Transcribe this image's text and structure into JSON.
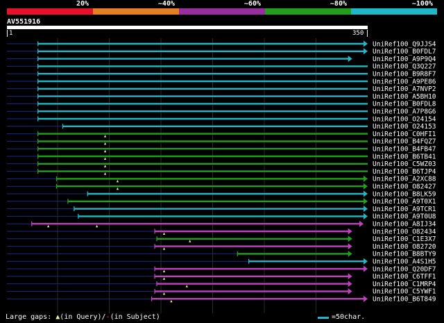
{
  "identity_scale": [
    {
      "label": "20%",
      "color": "#e8102a"
    },
    {
      "label": "~40%",
      "color": "#e8801e"
    },
    {
      "label": "~60%",
      "color": "#9a2ea0"
    },
    {
      "label": "~80%",
      "color": "#22a01c"
    },
    {
      "label": "~100%",
      "color": "#20b8c8"
    }
  ],
  "query": {
    "id": "AV551916",
    "start_label": "1",
    "end_label": "350",
    "length": 350
  },
  "colors": {
    "cyan": "#20b8c8",
    "green": "#22a01c",
    "purple": "#c040c0",
    "dashed": "#1a2a8a",
    "gap": "#f0f0a0"
  },
  "hits": [
    {
      "name": "UniRef100_Q9JJS4",
      "color": "cyan",
      "start": 31,
      "end": 350,
      "arrow": true,
      "gaps": []
    },
    {
      "name": "UniRef100_B0FDL7",
      "color": "cyan",
      "start": 31,
      "end": 350,
      "arrow": true,
      "gaps": []
    },
    {
      "name": "UniRef100_A9P9Q4",
      "color": "cyan",
      "start": 31,
      "end": 335,
      "arrow": true,
      "gaps": []
    },
    {
      "name": "UniRef100_Q3Q227",
      "color": "cyan",
      "start": 31,
      "end": 350,
      "arrow": false,
      "gaps": []
    },
    {
      "name": "UniRef100_B9R8F7",
      "color": "cyan",
      "start": 31,
      "end": 350,
      "arrow": false,
      "gaps": []
    },
    {
      "name": "UniRef100_A9PE86",
      "color": "cyan",
      "start": 31,
      "end": 350,
      "arrow": false,
      "gaps": []
    },
    {
      "name": "UniRef100_A7NVP2",
      "color": "cyan",
      "start": 31,
      "end": 350,
      "arrow": false,
      "gaps": []
    },
    {
      "name": "UniRef100_A5BH10",
      "color": "cyan",
      "start": 31,
      "end": 350,
      "arrow": false,
      "gaps": []
    },
    {
      "name": "UniRef100_B0FDL8",
      "color": "cyan",
      "start": 31,
      "end": 350,
      "arrow": false,
      "gaps": []
    },
    {
      "name": "UniRef100_A7P8G6",
      "color": "cyan",
      "start": 31,
      "end": 350,
      "arrow": false,
      "gaps": []
    },
    {
      "name": "UniRef100_O24154",
      "color": "cyan",
      "start": 31,
      "end": 350,
      "arrow": false,
      "gaps": []
    },
    {
      "name": "UniRef100_O24153",
      "color": "cyan",
      "start": 55,
      "end": 350,
      "arrow": false,
      "gaps": []
    },
    {
      "name": "UniRef100_C0HFI1",
      "color": "green",
      "start": 31,
      "end": 350,
      "arrow": false,
      "gaps": [
        96
      ]
    },
    {
      "name": "UniRef100_B4FQZ7",
      "color": "green",
      "start": 31,
      "end": 350,
      "arrow": false,
      "gaps": [
        96
      ]
    },
    {
      "name": "UniRef100_B4FB47",
      "color": "green",
      "start": 31,
      "end": 350,
      "arrow": false,
      "gaps": [
        96
      ]
    },
    {
      "name": "UniRef100_B6TB41",
      "color": "green",
      "start": 31,
      "end": 350,
      "arrow": false,
      "gaps": [
        96
      ]
    },
    {
      "name": "UniRef100_C5WZ03",
      "color": "green",
      "start": 31,
      "end": 350,
      "arrow": false,
      "gaps": [
        96
      ]
    },
    {
      "name": "UniRef100_B6TJP4",
      "color": "green",
      "start": 31,
      "end": 350,
      "arrow": false,
      "gaps": [
        96
      ]
    },
    {
      "name": "UniRef100_A2XC88",
      "color": "green",
      "start": 49,
      "end": 350,
      "arrow": true,
      "gaps": [
        108
      ]
    },
    {
      "name": "UniRef100_O82427",
      "color": "green",
      "start": 49,
      "end": 350,
      "arrow": true,
      "gaps": [
        108
      ]
    },
    {
      "name": "UniRef100_B8LK59",
      "color": "cyan",
      "start": 79,
      "end": 350,
      "arrow": true,
      "gaps": []
    },
    {
      "name": "UniRef100_A9T0X1",
      "color": "green",
      "start": 60,
      "end": 350,
      "arrow": true,
      "gaps": []
    },
    {
      "name": "UniRef100_A9TCR1",
      "color": "cyan",
      "start": 66,
      "end": 350,
      "arrow": true,
      "gaps": []
    },
    {
      "name": "UniRef100_A9T0U8",
      "color": "cyan",
      "start": 70,
      "end": 350,
      "arrow": true,
      "gaps": []
    },
    {
      "name": "UniRef100_A8IJ34",
      "color": "purple",
      "start": 25,
      "end": 346,
      "arrow": true,
      "gaps": [
        41,
        88
      ]
    },
    {
      "name": "UniRef100_O82434",
      "color": "purple",
      "start": 144,
      "end": 335,
      "arrow": true,
      "gaps": [
        153
      ]
    },
    {
      "name": "UniRef100_C1E3X7",
      "color": "green",
      "start": 146,
      "end": 335,
      "arrow": true,
      "gaps": [
        178
      ]
    },
    {
      "name": "UniRef100_O82720",
      "color": "purple",
      "start": 144,
      "end": 335,
      "arrow": true,
      "gaps": [
        153
      ]
    },
    {
      "name": "UniRef100_B8BTY9",
      "color": "green",
      "start": 224,
      "end": 335,
      "arrow": true,
      "gaps": []
    },
    {
      "name": "UniRef100_A4S1H5",
      "color": "cyan",
      "start": 235,
      "end": 350,
      "arrow": true,
      "gaps": []
    },
    {
      "name": "UniRef100_Q20DF7",
      "color": "purple",
      "start": 144,
      "end": 350,
      "arrow": true,
      "gaps": [
        153
      ]
    },
    {
      "name": "UniRef100_C6TFF1",
      "color": "purple",
      "start": 144,
      "end": 335,
      "arrow": true,
      "gaps": [
        153
      ]
    },
    {
      "name": "UniRef100_C1MRP4",
      "color": "purple",
      "start": 146,
      "end": 335,
      "arrow": true,
      "gaps": [
        175
      ]
    },
    {
      "name": "UniRef100_C5YWF1",
      "color": "purple",
      "start": 144,
      "end": 335,
      "arrow": true,
      "gaps": [
        153
      ]
    },
    {
      "name": "UniRef100_B6T849",
      "color": "purple",
      "start": 141,
      "end": 350,
      "arrow": true,
      "gaps": [
        160
      ]
    }
  ],
  "footer": {
    "gaps_label": "Large gaps:",
    "in_query": "(in Query)/",
    "in_subject": "(in Subject)",
    "scale_label": "=50char."
  }
}
